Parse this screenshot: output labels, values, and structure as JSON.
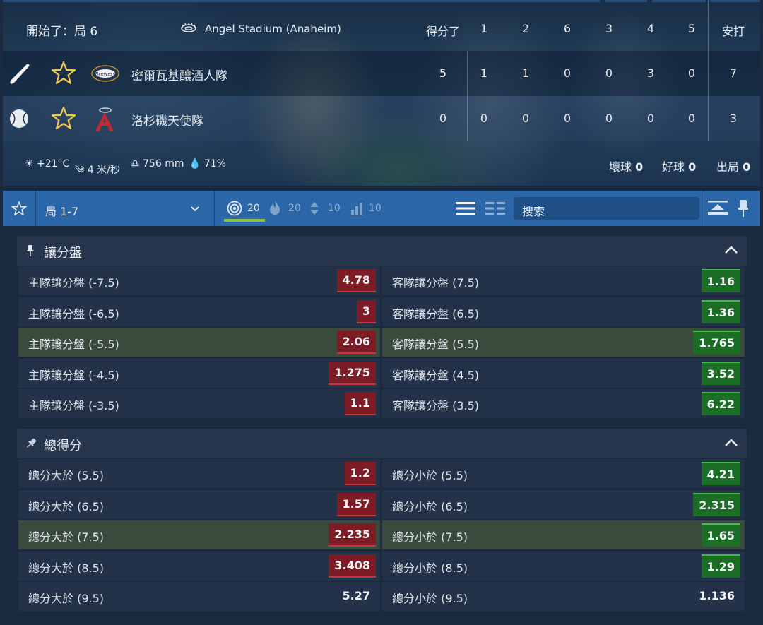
{
  "scoreboard": {
    "status": "開始了：局 6",
    "venue": "Angel Stadium (Anaheim)",
    "columns": [
      "得分了",
      "1",
      "2",
      "6",
      "3",
      "4",
      "5",
      "安打"
    ],
    "teams": [
      {
        "name": "密爾瓦基釀酒人隊",
        "runs": "5",
        "innings": [
          "1",
          "1",
          "0",
          "0",
          "3",
          "0"
        ],
        "hits": "7",
        "indicator": "bat-icon",
        "logo": "brewers-logo-icon"
      },
      {
        "name": "洛杉磯天使隊",
        "runs": "0",
        "innings": [
          "0",
          "0",
          "0",
          "0",
          "0",
          "0"
        ],
        "hits": "3",
        "indicator": "baseball-icon",
        "logo": "angels-logo-icon"
      }
    ],
    "weather": {
      "temp": "+21°C",
      "wind": "4 米/秒",
      "pressure": "756 mm",
      "humidity": "71%"
    },
    "counts": {
      "balls_label": "壞球",
      "balls": "0",
      "strikes_label": "好球",
      "strikes": "0",
      "outs_label": "出局",
      "outs": "0"
    }
  },
  "toolbar": {
    "period": "局 1-7",
    "filters": [
      {
        "icon": "target-icon",
        "count": "20"
      },
      {
        "icon": "fire-icon",
        "count": "20"
      },
      {
        "icon": "updown-icon",
        "count": "10"
      },
      {
        "icon": "stats-icon",
        "count": "10"
      }
    ],
    "search_placeholder": "搜索"
  },
  "colors": {
    "accent": "#2b66a8",
    "odd_down": "#7e1c26",
    "odd_up": "#1c6d25",
    "highlight_row": "#3a4b3e",
    "star": "#f2c94c"
  },
  "markets": [
    {
      "title": "讓分盤",
      "rows": [
        {
          "left": {
            "label": "主隊讓分盤 (-7.5)",
            "odd": "4.78",
            "trend": "down"
          },
          "right": {
            "label": "客隊讓分盤 (7.5)",
            "odd": "1.16",
            "trend": "up"
          },
          "highlight": false
        },
        {
          "left": {
            "label": "主隊讓分盤 (-6.5)",
            "odd": "3",
            "trend": "down"
          },
          "right": {
            "label": "客隊讓分盤 (6.5)",
            "odd": "1.36",
            "trend": "up"
          },
          "highlight": false
        },
        {
          "left": {
            "label": "主隊讓分盤 (-5.5)",
            "odd": "2.06",
            "trend": "down"
          },
          "right": {
            "label": "客隊讓分盤 (5.5)",
            "odd": "1.765",
            "trend": "up"
          },
          "highlight": true
        },
        {
          "left": {
            "label": "主隊讓分盤 (-4.5)",
            "odd": "1.275",
            "trend": "down"
          },
          "right": {
            "label": "客隊讓分盤 (4.5)",
            "odd": "3.52",
            "trend": "up"
          },
          "highlight": false
        },
        {
          "left": {
            "label": "主隊讓分盤 (-3.5)",
            "odd": "1.1",
            "trend": "down"
          },
          "right": {
            "label": "客隊讓分盤 (3.5)",
            "odd": "6.22",
            "trend": "up"
          },
          "highlight": false
        }
      ]
    },
    {
      "title": "總得分",
      "rows": [
        {
          "left": {
            "label": "總分大於 (5.5)",
            "odd": "1.2",
            "trend": "down"
          },
          "right": {
            "label": "總分小於 (5.5)",
            "odd": "4.21",
            "trend": "up"
          },
          "highlight": false
        },
        {
          "left": {
            "label": "總分大於 (6.5)",
            "odd": "1.57",
            "trend": "down"
          },
          "right": {
            "label": "總分小於 (6.5)",
            "odd": "2.315",
            "trend": "up"
          },
          "highlight": false
        },
        {
          "left": {
            "label": "總分大於 (7.5)",
            "odd": "2.235",
            "trend": "down"
          },
          "right": {
            "label": "總分小於 (7.5)",
            "odd": "1.65",
            "trend": "up"
          },
          "highlight": true
        },
        {
          "left": {
            "label": "總分大於 (8.5)",
            "odd": "3.408",
            "trend": "down"
          },
          "right": {
            "label": "總分小於 (8.5)",
            "odd": "1.29",
            "trend": "up"
          },
          "highlight": false
        },
        {
          "left": {
            "label": "總分大於 (9.5)",
            "odd": "5.27",
            "trend": "none"
          },
          "right": {
            "label": "總分小於 (9.5)",
            "odd": "1.136",
            "trend": "none"
          },
          "highlight": false
        }
      ]
    }
  ]
}
